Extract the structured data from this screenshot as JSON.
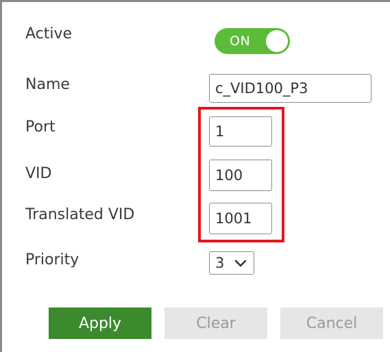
{
  "form": {
    "active": {
      "label": "Active",
      "toggle_text": "ON",
      "toggle_state": "on"
    },
    "name": {
      "label": "Name",
      "value": "c_VID100_P3"
    },
    "port": {
      "label": "Port",
      "value": "1"
    },
    "vid": {
      "label": "VID",
      "value": "100"
    },
    "translated_vid": {
      "label": "Translated VID",
      "value": "1001"
    },
    "priority": {
      "label": "Priority",
      "value": "3"
    }
  },
  "buttons": {
    "apply": "Apply",
    "clear": "Clear",
    "cancel": "Cancel"
  },
  "colors": {
    "toggle_on": "#5dbb3a",
    "apply": "#3c8a2e",
    "disabled_button": "#e6e6e6",
    "highlight": "#e3181e"
  },
  "icons": {
    "priority_dropdown": "chevron-down-icon"
  }
}
